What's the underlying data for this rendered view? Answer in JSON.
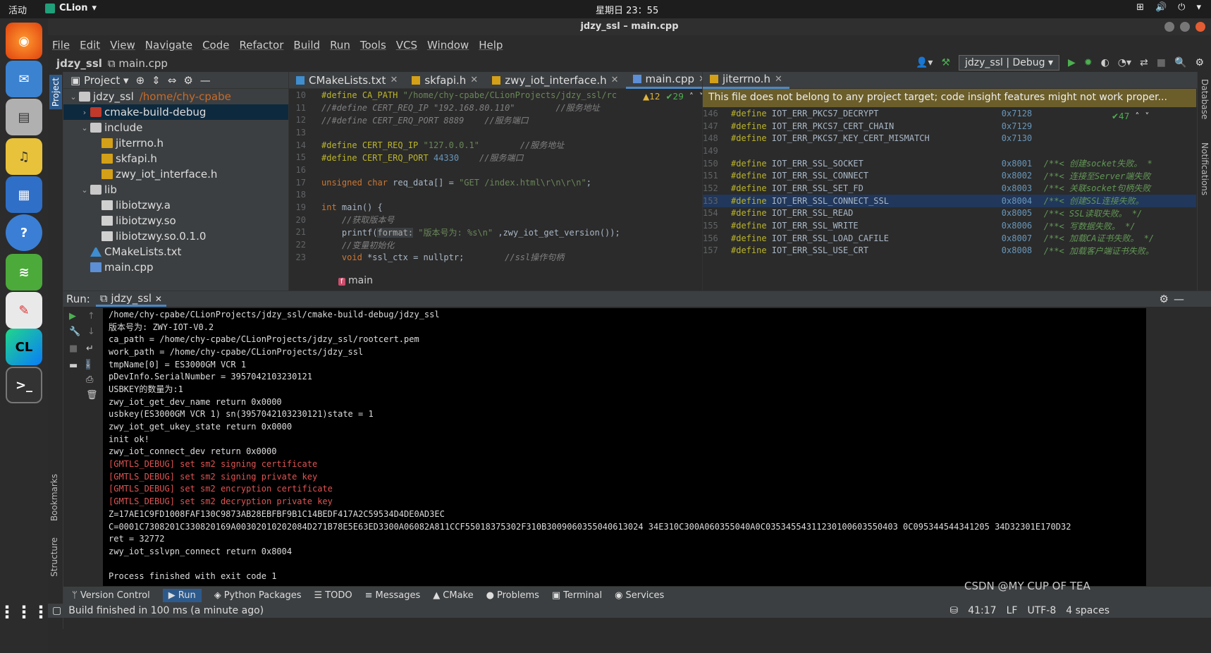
{
  "topbar": {
    "activities": "活动",
    "app_name": "CLion",
    "clock": "星期日 23：55"
  },
  "dock": {
    "tooltip": "终端",
    "apps": [
      "firefox",
      "thunderbird",
      "files",
      "rhythmbox",
      "writer",
      "help",
      "scanner",
      "text-editor",
      "clion",
      "terminal"
    ]
  },
  "window": {
    "title": "jdzy_ssl – main.cpp"
  },
  "menu": [
    "File",
    "Edit",
    "View",
    "Navigate",
    "Code",
    "Refactor",
    "Build",
    "Run",
    "Tools",
    "VCS",
    "Window",
    "Help"
  ],
  "nav": {
    "project": "jdzy_ssl",
    "file": "main.cpp"
  },
  "toolbar": {
    "run_config": "jdzy_ssl | Debug"
  },
  "project_panel": {
    "title": "Project",
    "tree": [
      {
        "label": "jdzy_ssl",
        "path": "/home/chy-cpabe",
        "level": 0,
        "arrow": "⌄",
        "icon": "fold"
      },
      {
        "label": "cmake-build-debug",
        "level": 1,
        "arrow": "›",
        "icon": "foldr",
        "selected": true
      },
      {
        "label": "include",
        "level": 1,
        "arrow": "⌄",
        "icon": "fold"
      },
      {
        "label": "jiterrno.h",
        "level": 2,
        "arrow": "",
        "icon": "hfile"
      },
      {
        "label": "skfapi.h",
        "level": 2,
        "arrow": "",
        "icon": "hfile"
      },
      {
        "label": "zwy_iot_interface.h",
        "level": 2,
        "arrow": "",
        "icon": "hfile"
      },
      {
        "label": "lib",
        "level": 1,
        "arrow": "⌄",
        "icon": "fold"
      },
      {
        "label": "libiotzwy.a",
        "level": 2,
        "arrow": "",
        "icon": "libf"
      },
      {
        "label": "libiotzwy.so",
        "level": 2,
        "arrow": "",
        "icon": "libf"
      },
      {
        "label": "libiotzwy.so.0.1.0",
        "level": 2,
        "arrow": "",
        "icon": "libf"
      },
      {
        "label": "CMakeLists.txt",
        "level": 1,
        "arrow": "",
        "icon": "cmk"
      },
      {
        "label": "main.cpp",
        "level": 1,
        "arrow": "",
        "icon": "cppf"
      }
    ]
  },
  "editor_left": {
    "tabs": [
      {
        "label": "CMakeLists.txt",
        "active": false
      },
      {
        "label": "skfapi.h",
        "active": false
      },
      {
        "label": "zwy_iot_interface.h",
        "active": false
      },
      {
        "label": "main.cpp",
        "active": true
      }
    ],
    "warnings": "▲12",
    "checks": "✔29",
    "breadcrumb": "main",
    "lines": [
      {
        "n": "10",
        "html": "<span class='pp'>#define</span> <span class='pp'>CA_PATH</span> <span class='st'>\"/home/chy-cpabe/CLionProjects/jdzy_ssl/rc</span>"
      },
      {
        "n": "11",
        "html": "<span class='cm'>//#define CERT_REQ_IP \"192.168.80.110\"        //服务地址</span>"
      },
      {
        "n": "12",
        "html": "<span class='cm'>//#define CERT_ERQ_PORT 8889    //服务端口</span>"
      },
      {
        "n": "13",
        "html": ""
      },
      {
        "n": "14",
        "html": "<span class='pp'>#define</span> <span class='pp'>CERT_REQ_IP</span> <span class='st'>\"127.0.0.1\"</span>        <span class='cm'>//服务地址</span>"
      },
      {
        "n": "15",
        "html": "<span class='pp'>#define</span> <span class='pp'>CERT_ERQ_PORT</span> <span class='nm'>44330</span>    <span class='cm'>//服务端口</span>"
      },
      {
        "n": "16",
        "html": ""
      },
      {
        "n": "17",
        "html": "<span class='kw'>unsigned char</span> <span class='df'>req_data[] = </span><span class='st'>\"GET /index.html\\r\\n\\r\\n\"</span><span class='df'>;</span>"
      },
      {
        "n": "18",
        "html": ""
      },
      {
        "n": "19",
        "html": "<span class='kw'>int</span> <span class='df'>main() {</span>"
      },
      {
        "n": "20",
        "html": "    <span class='cm'>//获取版本号</span>"
      },
      {
        "n": "21",
        "html": "    <span class='df'>printf(</span><span style='background:#3c3f41;color:#aaa'>format:</span> <span class='st'>\"版本号为: %s\\n\"</span> <span class='df'>,zwy_iot_get_version());</span>"
      },
      {
        "n": "22",
        "html": "    <span class='cm'>//变量初始化</span>"
      },
      {
        "n": "23",
        "html": "    <span class='kw'>void</span> <span class='df'>*ssl_ctx = nullptr;</span>        <span class='cm'>//ssl操作句柄</span>"
      }
    ]
  },
  "editor_right": {
    "tabs": [
      {
        "label": "jiterrno.h",
        "active": true
      }
    ],
    "notice": "This file does not belong to any project target; code insight features might not work proper...",
    "checks": "✔47",
    "lines": [
      {
        "n": "146",
        "name": "IOT_ERR_PKCS7_DECRYPT",
        "val": "0x7128",
        "cmt": ""
      },
      {
        "n": "147",
        "name": "IOT_ERR_PKCS7_CERT_CHAIN",
        "val": "0x7129",
        "cmt": ""
      },
      {
        "n": "148",
        "name": "IOT_ERR_PKCS7_KEY_CERT_MISMATCH",
        "val": "0x7130",
        "cmt": ""
      },
      {
        "n": "149",
        "name": "",
        "val": "",
        "cmt": ""
      },
      {
        "n": "150",
        "name": "IOT_ERR_SSL_SOCKET",
        "val": "0x8001",
        "cmt": "/**< 创建socket失败。 *"
      },
      {
        "n": "151",
        "name": "IOT_ERR_SSL_CONNECT",
        "val": "0x8002",
        "cmt": "/**< 连接至Server端失败"
      },
      {
        "n": "152",
        "name": "IOT_ERR_SSL_SET_FD",
        "val": "0x8003",
        "cmt": "/**< 关联socket句柄失败"
      },
      {
        "n": "153",
        "name": "IOT_ERR_SSL_CONNECT_SSL",
        "val": "0x8004",
        "cmt": "/**< 创建SSL连接失败。",
        "hl": true
      },
      {
        "n": "154",
        "name": "IOT_ERR_SSL_READ",
        "val": "0x8005",
        "cmt": "/**< SSL读取失败。 */"
      },
      {
        "n": "155",
        "name": "IOT_ERR_SSL_WRITE",
        "val": "0x8006",
        "cmt": "/**< 写数据失败。 */"
      },
      {
        "n": "156",
        "name": "IOT_ERR_SSL_LOAD_CAFILE",
        "val": "0x8007",
        "cmt": "/**< 加载CA证书失败。 */"
      },
      {
        "n": "157",
        "name": "IOT_ERR_SSL_USE_CRT",
        "val": "0x8008",
        "cmt": "/**< 加载客户端证书失败。"
      }
    ]
  },
  "run_panel": {
    "label": "Run:",
    "tab": "jdzy_ssl",
    "output": [
      {
        "t": "/home/chy-cpabe/CLionProjects/jdzy_ssl/cmake-build-debug/jdzy_ssl",
        "red": false
      },
      {
        "t": "版本号为: ZWY-IOT-V0.2",
        "red": false
      },
      {
        "t": "ca_path = /home/chy-cpabe/CLionProjects/jdzy_ssl/rootcert.pem",
        "red": false
      },
      {
        "t": "work_path = /home/chy-cpabe/CLionProjects/jdzy_ssl",
        "red": false
      },
      {
        "t": "tmpName[0] = ES3000GM VCR 1",
        "red": false
      },
      {
        "t": "pDevInfo.SerialNumber = 3957042103230121",
        "red": false
      },
      {
        "t": "USBKEY的数量为:1",
        "red": false
      },
      {
        "t": "zwy_iot_get_dev_name return 0x0000",
        "red": false
      },
      {
        "t": "usbkey(ES3000GM VCR 1) sn(3957042103230121)state = 1",
        "red": false
      },
      {
        "t": "zwy_iot_get_ukey_state return 0x0000",
        "red": false
      },
      {
        "t": "init ok!",
        "red": false
      },
      {
        "t": "zwy_iot_connect_dev return 0x0000",
        "red": false
      },
      {
        "t": "[GMTLS_DEBUG] set sm2 signing certificate",
        "red": true
      },
      {
        "t": "[GMTLS_DEBUG] set sm2 signing private key",
        "red": true
      },
      {
        "t": "[GMTLS_DEBUG] set sm2 encryption certificate",
        "red": true
      },
      {
        "t": "[GMTLS_DEBUG] set sm2 decryption private key",
        "red": true
      },
      {
        "t": "Z=17AE1C9FD1008FAF130C9873AB28EBFBF9B1C14BEDF417A2C59534D4DE0AD3EC",
        "red": false
      },
      {
        "t": "C=0001C7308201C330820169A00302010202084D271B78E5E63ED3300A06082A811CCF55018375302F310B3009060355040613024 34E310C300A060355040A0C03534554311230100603550403 0C095344544341205 34D32301E170D32",
        "red": false
      },
      {
        "t": "ret = 32772",
        "red": false
      },
      {
        "t": "zwy_iot_sslvpn_connect return 0x8004",
        "red": false
      },
      {
        "t": "",
        "red": false
      },
      {
        "t": "Process finished with exit code 1",
        "red": false
      }
    ]
  },
  "bottom_tabs": [
    {
      "label": "Version Control",
      "icon": "ᛘ",
      "active": false
    },
    {
      "label": "Run",
      "icon": "▶",
      "active": true
    },
    {
      "label": "Python Packages",
      "icon": "◈",
      "active": false
    },
    {
      "label": "TODO",
      "icon": "☰",
      "active": false
    },
    {
      "label": "Messages",
      "icon": "≡",
      "active": false
    },
    {
      "label": "CMake",
      "icon": "▲",
      "active": false
    },
    {
      "label": "Problems",
      "icon": "●",
      "active": false
    },
    {
      "label": "Terminal",
      "icon": "▣",
      "active": false
    },
    {
      "label": "Services",
      "icon": "◉",
      "active": false
    }
  ],
  "statusbar": {
    "message": "Build finished in 100 ms (a minute ago)",
    "position": "41:17",
    "line_sep": "LF",
    "encoding": "UTF-8",
    "indent": "4 spaces"
  },
  "right_stripe": {
    "database": "Database",
    "notifications": "Notifications"
  },
  "left_stripe": {
    "project": "Project",
    "bookmarks": "Bookmarks",
    "structure": "Structure"
  },
  "watermark": "CSDN @MY CUP OF TEA"
}
